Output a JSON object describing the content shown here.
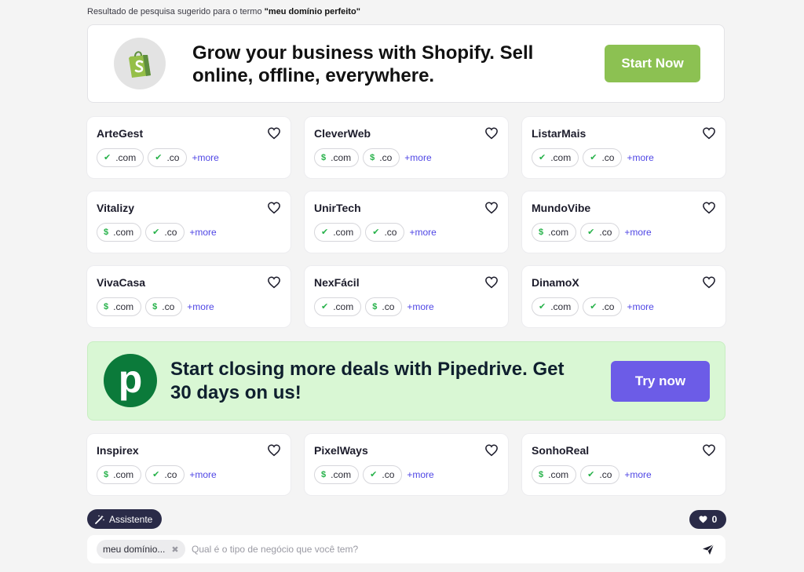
{
  "search_note": {
    "prefix": "Resultado de pesquisa sugerido para o termo ",
    "term": "\"meu domínio perfeito\""
  },
  "ad_shopify": {
    "text": "Grow your business with Shopify. Sell online, offline, everywhere.",
    "button": "Start Now"
  },
  "ad_pipedrive": {
    "logo_letter": "p",
    "text": "Start closing more deals with Pipedrive. Get 30 days on us!",
    "button": "Try now"
  },
  "cards": [
    {
      "name": "ArteGest",
      "tlds": [
        {
          "ext": ".com",
          "status": "available"
        },
        {
          "ext": ".co",
          "status": "available"
        }
      ],
      "more": "+more"
    },
    {
      "name": "CleverWeb",
      "tlds": [
        {
          "ext": ".com",
          "status": "premium"
        },
        {
          "ext": ".co",
          "status": "premium"
        }
      ],
      "more": "+more"
    },
    {
      "name": "ListarMais",
      "tlds": [
        {
          "ext": ".com",
          "status": "available"
        },
        {
          "ext": ".co",
          "status": "available"
        }
      ],
      "more": "+more"
    },
    {
      "name": "Vitalizy",
      "tlds": [
        {
          "ext": ".com",
          "status": "premium"
        },
        {
          "ext": ".co",
          "status": "available"
        }
      ],
      "more": "+more"
    },
    {
      "name": "UnirTech",
      "tlds": [
        {
          "ext": ".com",
          "status": "available"
        },
        {
          "ext": ".co",
          "status": "available"
        }
      ],
      "more": "+more"
    },
    {
      "name": "MundoVibe",
      "tlds": [
        {
          "ext": ".com",
          "status": "premium"
        },
        {
          "ext": ".co",
          "status": "available"
        }
      ],
      "more": "+more"
    },
    {
      "name": "VivaCasa",
      "tlds": [
        {
          "ext": ".com",
          "status": "premium"
        },
        {
          "ext": ".co",
          "status": "premium"
        }
      ],
      "more": "+more"
    },
    {
      "name": "NexFácil",
      "tlds": [
        {
          "ext": ".com",
          "status": "available"
        },
        {
          "ext": ".co",
          "status": "premium"
        }
      ],
      "more": "+more"
    },
    {
      "name": "DinamoX",
      "tlds": [
        {
          "ext": ".com",
          "status": "available"
        },
        {
          "ext": ".co",
          "status": "available"
        }
      ],
      "more": "+more"
    },
    {
      "name": "Inspirex",
      "tlds": [
        {
          "ext": ".com",
          "status": "premium"
        },
        {
          "ext": ".co",
          "status": "available"
        }
      ],
      "more": "+more"
    },
    {
      "name": "PixelWays",
      "tlds": [
        {
          "ext": ".com",
          "status": "premium"
        },
        {
          "ext": ".co",
          "status": "available"
        }
      ],
      "more": "+more"
    },
    {
      "name": "SonhoReal",
      "tlds": [
        {
          "ext": ".com",
          "status": "premium"
        },
        {
          "ext": ".co",
          "status": "available"
        }
      ],
      "more": "+more"
    }
  ],
  "assistant": {
    "label": "Assistente"
  },
  "favorites": {
    "count": "0"
  },
  "chat": {
    "term_chip": "meu domínio...",
    "placeholder": "Qual é o tipo de negócio que você tem?"
  },
  "colors": {
    "check": "#27b24a",
    "more_link": "#4f46e5",
    "shopify_button": "#8cc152",
    "pipedrive_button": "#6c5ce7",
    "pipedrive_bg": "#d9f7d4",
    "dark_pill": "#2a2b48"
  }
}
